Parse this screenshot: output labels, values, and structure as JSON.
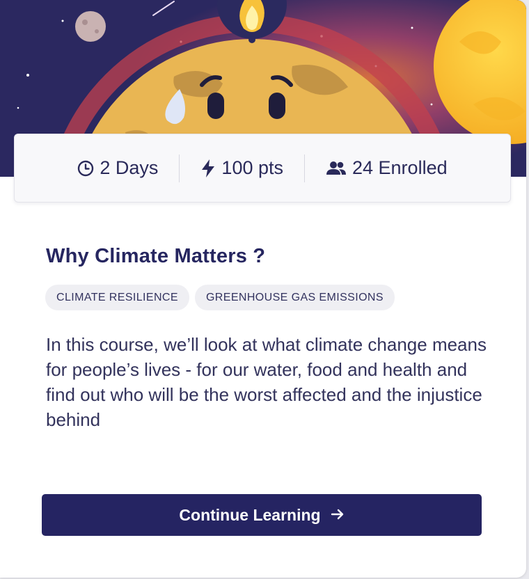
{
  "stats": {
    "duration": "2 Days",
    "points": "100 pts",
    "enrolled": "24 Enrolled",
    "duration_icon": "clock-icon",
    "points_icon": "lightning-icon",
    "enrolled_icon": "people-icon"
  },
  "course": {
    "title": "Why Climate Matters ?",
    "tags": [
      "CLIMATE RESILIENCE",
      "GREENHOUSE GAS EMISSIONS"
    ],
    "description": "In this course, we’ll look at what climate change means for people’s lives - for our water, food and health and find out who will be the worst affected and the injustice behind"
  },
  "cta": {
    "label": "Continue Learning",
    "icon": "arrow-right-icon"
  },
  "colors": {
    "primary": "#252462",
    "text": "#262660",
    "tag_bg": "#efeff3",
    "sky": "#2b2860",
    "sun": "#f9c22e"
  }
}
